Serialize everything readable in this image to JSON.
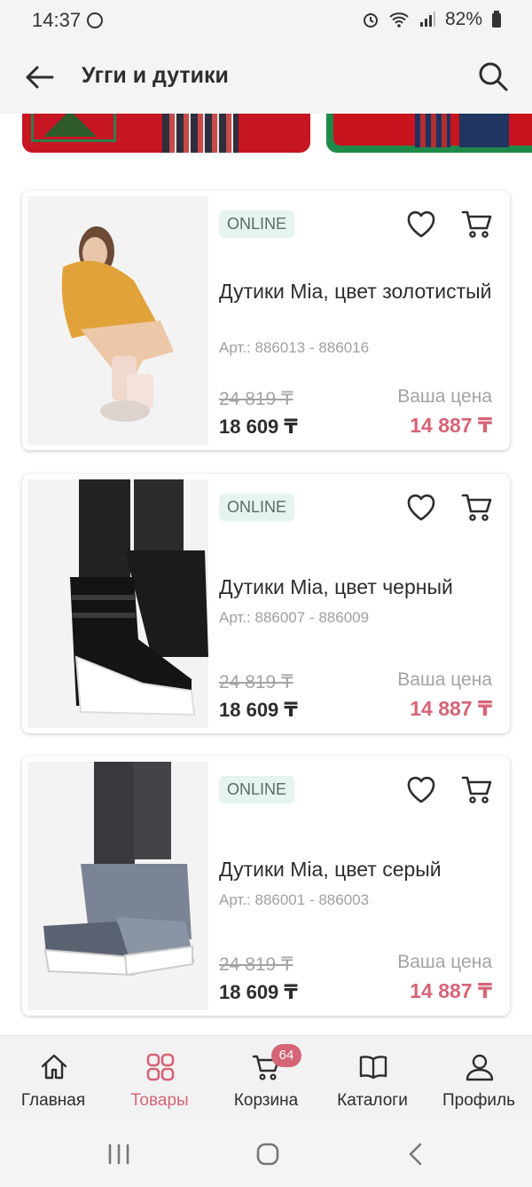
{
  "status_bar": {
    "time": "14:37",
    "battery": "82%"
  },
  "header": {
    "title": "Угги и дутики"
  },
  "products": [
    {
      "badge": "ONLINE",
      "title": "Дутики Mia, цвет золотистый",
      "article": "Арт.: 886013 - 886016",
      "old_price": "24 819 ₸",
      "price": "18 609 ₸",
      "your_price_label": "Ваша цена",
      "your_price": "14 887 ₸"
    },
    {
      "badge": "ONLINE",
      "title": "Дутики Mia, цвет черный",
      "article": "Арт.: 886007 - 886009",
      "old_price": "24 819 ₸",
      "price": "18 609 ₸",
      "your_price_label": "Ваша цена",
      "your_price": "14 887 ₸"
    },
    {
      "badge": "ONLINE",
      "title": "Дутики Mia, цвет серый",
      "article": "Арт.: 886001 - 886003",
      "old_price": "24 819 ₸",
      "price": "18 609 ₸",
      "your_price_label": "Ваша цена",
      "your_price": "14 887 ₸"
    }
  ],
  "bottom_nav": {
    "items": [
      {
        "label": "Главная",
        "icon": "home-icon"
      },
      {
        "label": "Товары",
        "icon": "grid-icon",
        "active": true
      },
      {
        "label": "Корзина",
        "icon": "cart-icon",
        "badge": "64"
      },
      {
        "label": "Каталоги",
        "icon": "book-icon"
      },
      {
        "label": "Профиль",
        "icon": "user-icon"
      }
    ]
  },
  "colors": {
    "accent": "#d66477",
    "badge_bg": "#e5f5ee"
  }
}
